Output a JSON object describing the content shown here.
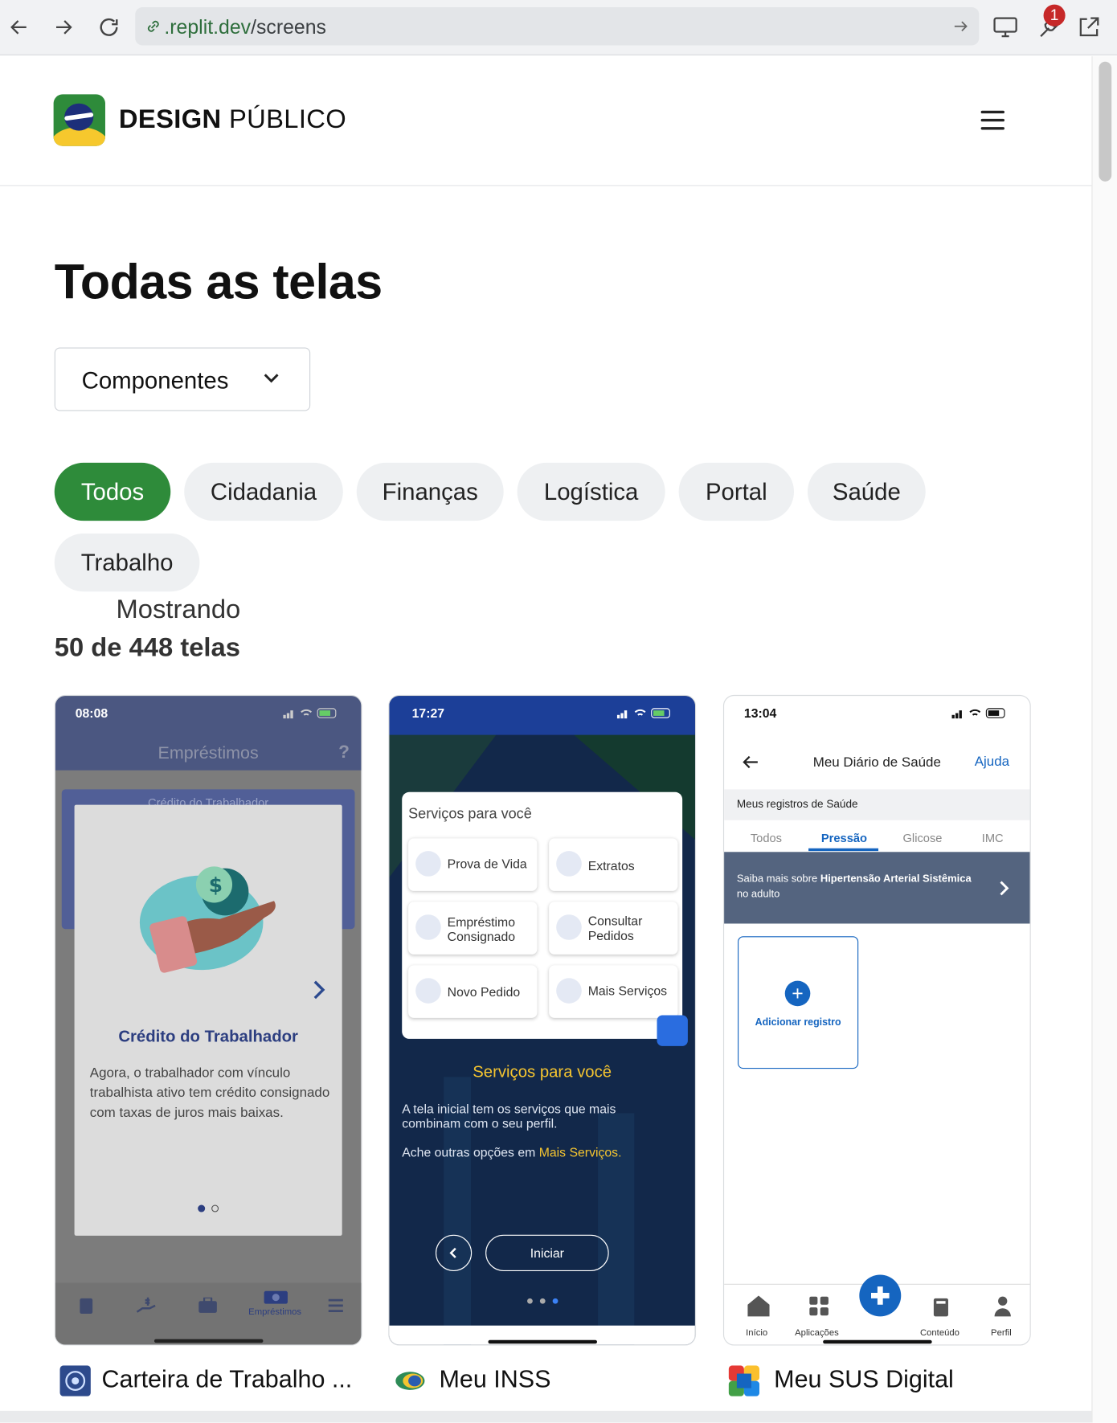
{
  "browser": {
    "url_host": ".replit.dev",
    "url_path": "/screens",
    "notification_count": "1"
  },
  "header": {
    "brand_bold": "DESIGN",
    "brand_regular": "PÚBLICO"
  },
  "main": {
    "title": "Todas as telas",
    "filter_dropdown": "Componentes",
    "categories": [
      "Todos",
      "Cidadania",
      "Finanças",
      "Logística",
      "Portal",
      "Saúde",
      "Trabalho"
    ],
    "active_category": "Todos",
    "count_line1": "Mostrando",
    "count_line2": "50 de 448 telas"
  },
  "cards": [
    {
      "app_name": "Carteira de Trabalho ...",
      "screen": {
        "time": "08:08",
        "header_title": "Empréstimos",
        "help": "?",
        "bg_card_title": "Crédito do Trabalhador",
        "modal_title": "Crédito do Trabalhador",
        "modal_text": "Agora, o trabalhador com vínculo trabalhista ativo tem crédito consignado com taxas de juros mais baixas.",
        "nav_active_label": "Empréstimos",
        "nav_icons": [
          "wallet-icon",
          "hand-money-icon",
          "briefcase-icon",
          "cash-icon",
          "menu-icon"
        ]
      }
    },
    {
      "app_name": "Meu INSS",
      "screen": {
        "time": "17:27",
        "panel_title": "Serviços para você",
        "tiles": [
          {
            "label": "Prova de Vida",
            "icon": "person-icon"
          },
          {
            "label": "Extratos",
            "icon": "document-icon"
          },
          {
            "label": "Empréstimo\nConsignado",
            "icon": "money-icon"
          },
          {
            "label": "Consultar\nPedidos",
            "icon": "search-icon"
          },
          {
            "label": "Novo Pedido",
            "icon": "plus-icon"
          },
          {
            "label": "Mais Serviços",
            "icon": "dots-icon"
          }
        ],
        "heading": "Serviços para você",
        "text1": "A tela inicial tem os serviços que mais combinam com o seu perfil.",
        "text2_prefix": "Ache outras opções em ",
        "text2_link": "Mais Serviços.",
        "start_button": "Iniciar"
      }
    },
    {
      "app_name": "Meu SUS Digital",
      "screen": {
        "time": "13:04",
        "title": "Meu Diário de Saúde",
        "help_link": "Ajuda",
        "section": "Meus registros de Saúde",
        "tabs": [
          "Todos",
          "Pressão",
          "Glicose",
          "IMC"
        ],
        "active_tab": "Pressão",
        "banner_prefix": "Saiba mais sobre ",
        "banner_bold": "Hipertensão Arterial Sistêmica",
        "banner_suffix": "no adulto",
        "add_record": "Adicionar registro",
        "nav": [
          "Início",
          "Aplicações",
          "Conteúdo",
          "Perfil"
        ]
      }
    }
  ],
  "colors": {
    "brand_green": "#2e8b3a",
    "inss_blue": "#1c3f98",
    "sus_blue": "#1565c0",
    "ctps_navy": "#2c3e80"
  }
}
